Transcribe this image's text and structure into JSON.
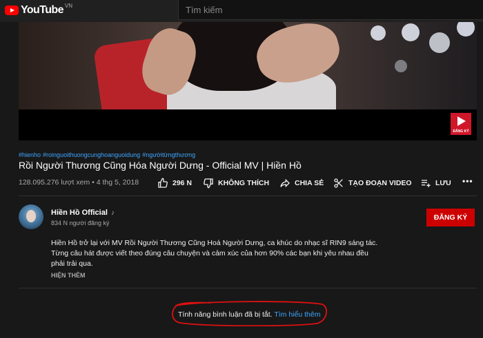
{
  "header": {
    "logo_text": "YouTube",
    "region": "VN",
    "search_placeholder": "Tìm kiếm"
  },
  "player": {
    "badge_label": "ĐĂNG KÝ"
  },
  "video": {
    "hashtags": [
      "#hienho",
      "#roinguoithuongcunghoanguoidung",
      "#ngườitừngthương"
    ],
    "title": "Rồi Người Thương Cũng Hóa Người Dưng - Official MV | Hiền Hồ",
    "views": "128.095.276 lượt xem • 4 thg 5, 2018"
  },
  "actions": {
    "like_count": "296 N",
    "dislike_label": "KHÔNG THÍCH",
    "share_label": "CHIA SẺ",
    "clip_label": "TẠO ĐOẠN VIDEO",
    "save_label": "LƯU",
    "more_label": "•••"
  },
  "channel": {
    "name": "Hiền Hồ Official",
    "note_icon": "music-note-icon",
    "subscribers": "834 N người đăng ký",
    "subscribe_label": "ĐĂNG KÝ"
  },
  "description": {
    "lines": [
      "Hiền Hồ trở lại với MV Rồi Người Thương Cũng Hoá Người Dưng, ca khúc do nhạc sĩ RIN9 sáng tác.",
      "Từng câu hát được viết theo đúng câu chuyện và cảm xúc của  hơn 90% các bạn khi yêu nhau đều",
      "phải trải qua."
    ],
    "show_more_label": "HIỆN THÊM"
  },
  "comments": {
    "disabled_text": "Tính năng bình luận đã bị tắt.",
    "learn_more_label": "Tìm hiểu thêm"
  },
  "colors": {
    "background": "#181818",
    "accent_red": "#cc0000",
    "link_blue": "#3ea6ff",
    "annotation_red": "#e01010"
  }
}
